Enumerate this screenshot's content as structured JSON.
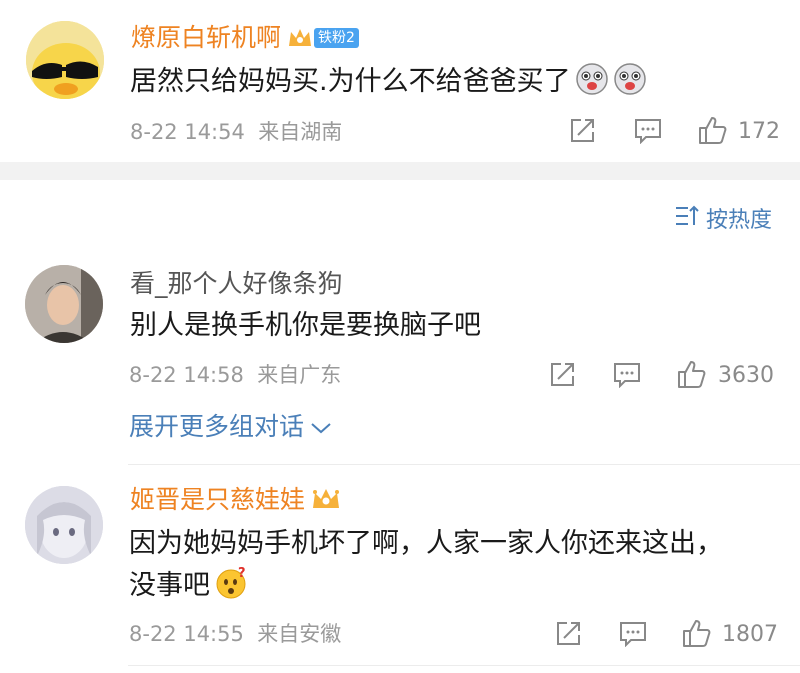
{
  "comments": [
    {
      "username": "燎原白斩机啊",
      "fan_badge": "铁粉2",
      "content": "居然只给妈妈买.为什么不给爸爸买了",
      "time": "8-22 14:54",
      "location": "来自湖南",
      "likes": "172"
    },
    {
      "username": "看_那个人好像条狗",
      "content": "别人是换手机你是要换脑子吧",
      "time": "8-22 14:58",
      "location": "来自广东",
      "likes": "3630"
    },
    {
      "username": "姬晋是只慈娃娃",
      "content_line1": "因为她妈妈手机坏了啊，人家一家人你还来这出，",
      "content_line2": "没事吧",
      "time": "8-22 14:55",
      "location": "来自安徽",
      "likes": "1807"
    }
  ],
  "sort_label": "按热度",
  "expand_label": "展开更多组对话",
  "colors": {
    "vip_name": "#ee8322",
    "link_blue": "#4a7fb8",
    "meta_gray": "#9a9a9a"
  }
}
